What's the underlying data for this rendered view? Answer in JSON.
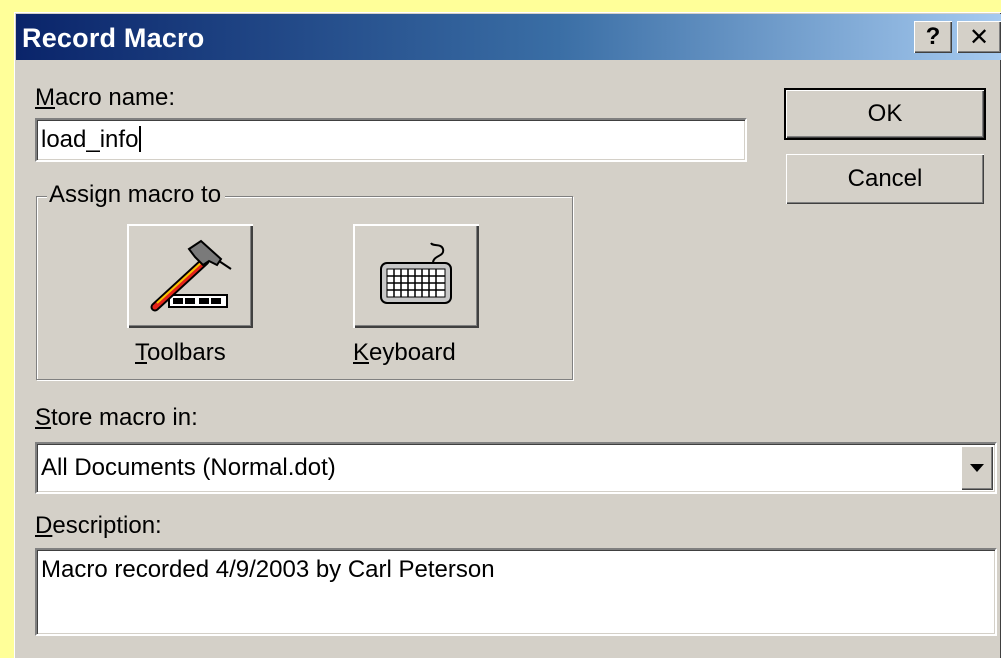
{
  "dialog": {
    "title": "Record Macro",
    "help_glyph": "?",
    "close_glyph": "✕"
  },
  "macro_name": {
    "label_accel": "M",
    "label_rest": "acro name:",
    "value": "load_info"
  },
  "buttons": {
    "ok": "OK",
    "cancel": "Cancel"
  },
  "assign": {
    "legend": "Assign macro to",
    "toolbars_accel": "T",
    "toolbars_rest": "oolbars",
    "keyboard_accel": "K",
    "keyboard_rest": "eyboard",
    "toolbars_icon": "hammer-toolbar-icon",
    "keyboard_icon": "keyboard-icon"
  },
  "store": {
    "label_accel": "S",
    "label_rest": "tore macro in:",
    "selected": "All Documents (Normal.dot)",
    "arrow_icon": "chevron-down-icon"
  },
  "description": {
    "label_accel": "D",
    "label_rest": "escription:",
    "value": "Macro recorded 4/9/2003 by Carl Peterson"
  },
  "colors": {
    "page_background": "#ffff99",
    "dialog_face": "#d4d0c8",
    "title_start": "#0a246a",
    "title_end": "#a6caf0"
  }
}
